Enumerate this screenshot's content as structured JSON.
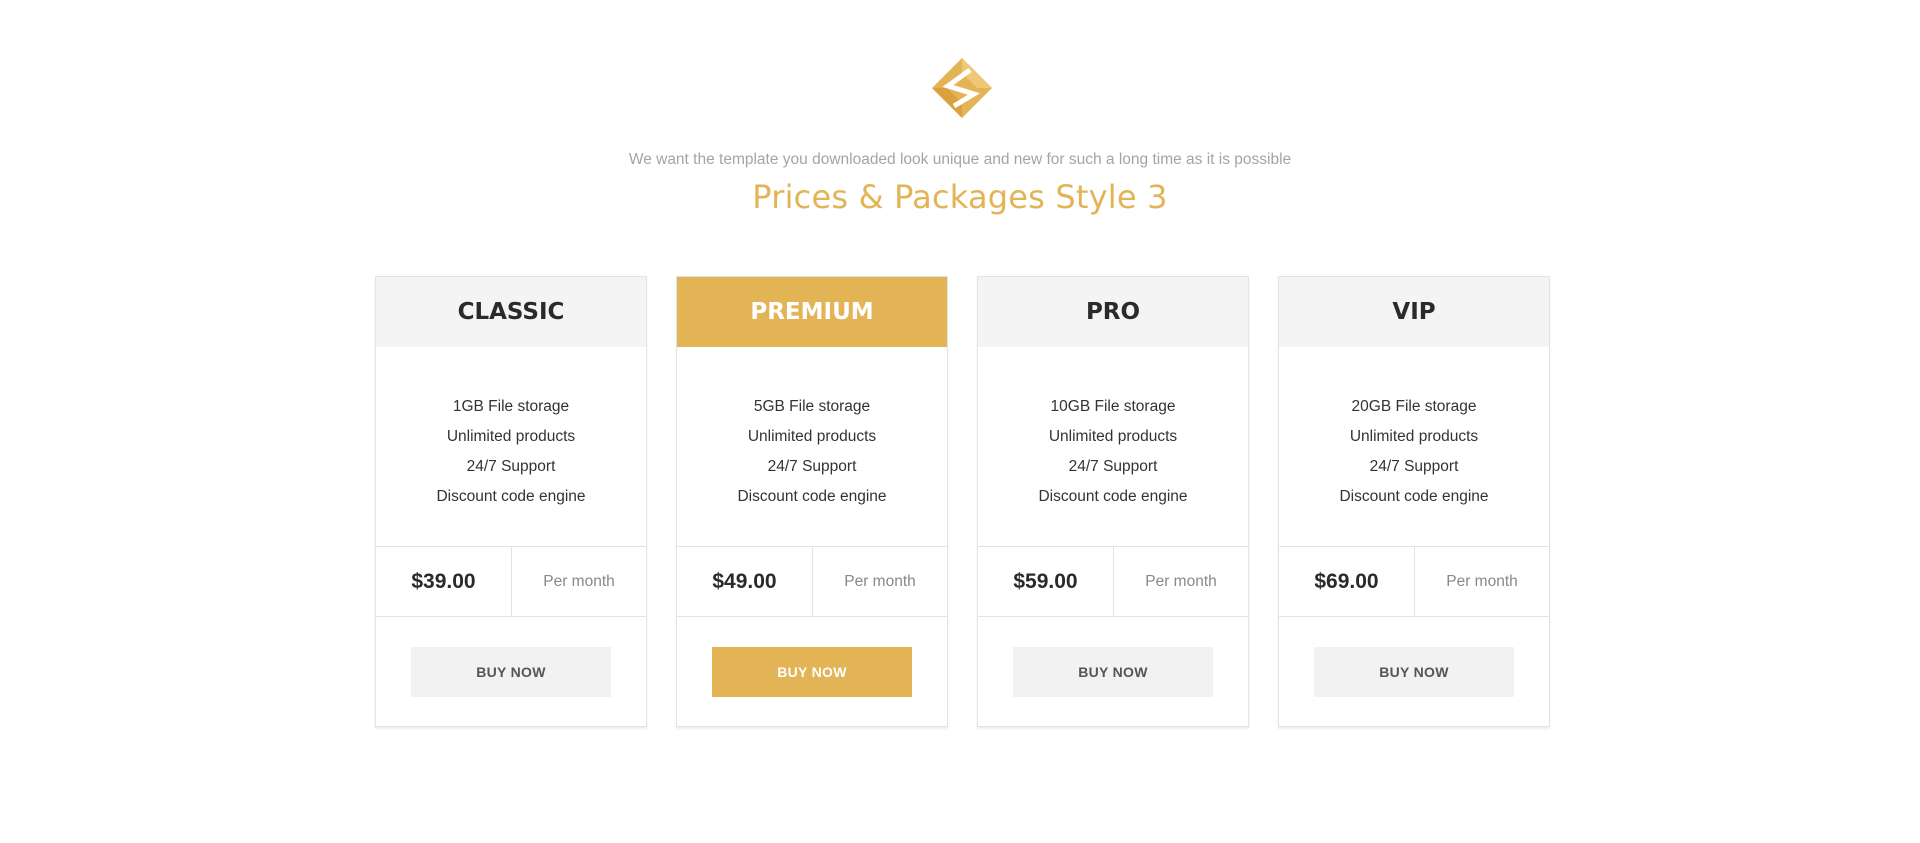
{
  "header": {
    "logo": "stack-logo-icon",
    "subtitle": "We want the template you downloaded look unique and new for such a long time as it is possible",
    "title": "Prices & Packages Style 3"
  },
  "colors": {
    "accent": "#e2b455",
    "header_bg": "#f4f4f4",
    "button_bg": "#f2f2f2",
    "text_dark": "#2a2a2a",
    "text_muted": "#888888"
  },
  "plans": [
    {
      "name": "CLASSIC",
      "featured": false,
      "features": [
        "1GB File storage",
        "Unlimited products",
        "24/7 Support",
        "Discount code engine"
      ],
      "price": "$39.00",
      "period": "Per month",
      "button": "BUY NOW"
    },
    {
      "name": "PREMIUM",
      "featured": true,
      "features": [
        "5GB File storage",
        "Unlimited products",
        "24/7 Support",
        "Discount code engine"
      ],
      "price": "$49.00",
      "period": "Per month",
      "button": "BUY NOW"
    },
    {
      "name": "PRO",
      "featured": false,
      "features": [
        "10GB File storage",
        "Unlimited products",
        "24/7 Support",
        "Discount code engine"
      ],
      "price": "$59.00",
      "period": "Per month",
      "button": "BUY NOW"
    },
    {
      "name": "VIP",
      "featured": false,
      "features": [
        "20GB File storage",
        "Unlimited products",
        "24/7 Support",
        "Discount code engine"
      ],
      "price": "$69.00",
      "period": "Per month",
      "button": "BUY NOW"
    }
  ]
}
